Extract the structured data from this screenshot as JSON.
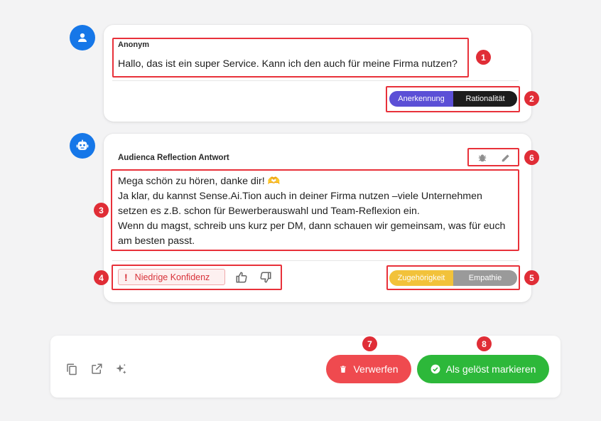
{
  "user_message": {
    "author": "Anonym",
    "text": "Hallo, das ist ein super Service. Kann ich den auch für meine Firma nutzen?",
    "tags": [
      "Anerkennung",
      "Rationalität"
    ]
  },
  "bot_message": {
    "title": "Audienca Reflection Antwort",
    "lines": [
      "Mega schön zu hören, danke dir! 🫶",
      "Ja klar, du kannst Sense.Ai.Tion auch in deiner Firma nutzen –viele Unternehmen",
      "setzen es z.B. schon für Bewerberauswahl und Team-Reflexion ein.",
      "Wenn du magst, schreib uns kurz per DM, dann schauen wir gemeinsam, was für euch",
      "am besten passt."
    ],
    "confidence_badge": "Niedrige Konfidenz",
    "tags": [
      "Zugehörigkeit",
      "Empathie"
    ]
  },
  "actions": {
    "discard_label": "Verwerfen",
    "resolve_label": "Als gelöst markieren"
  },
  "callouts": [
    "1",
    "2",
    "3",
    "4",
    "5",
    "6",
    "7",
    "8"
  ],
  "colors": {
    "avatar": "#1677e8",
    "tag_blue": "#5b4fd6",
    "tag_dark": "#1c1c1c",
    "tag_yellow": "#f2c23a",
    "tag_gray": "#9a9a9a",
    "discard": "#ef4a4f",
    "resolve": "#2db83a",
    "annotation": "#e02d36"
  },
  "icons": [
    "user-icon",
    "robot-icon",
    "bug-icon",
    "pencil-icon",
    "thumbs-up-icon",
    "thumbs-down-icon",
    "copy-icon",
    "open-external-icon",
    "sparkles-icon",
    "trash-icon",
    "check-circle-icon"
  ]
}
